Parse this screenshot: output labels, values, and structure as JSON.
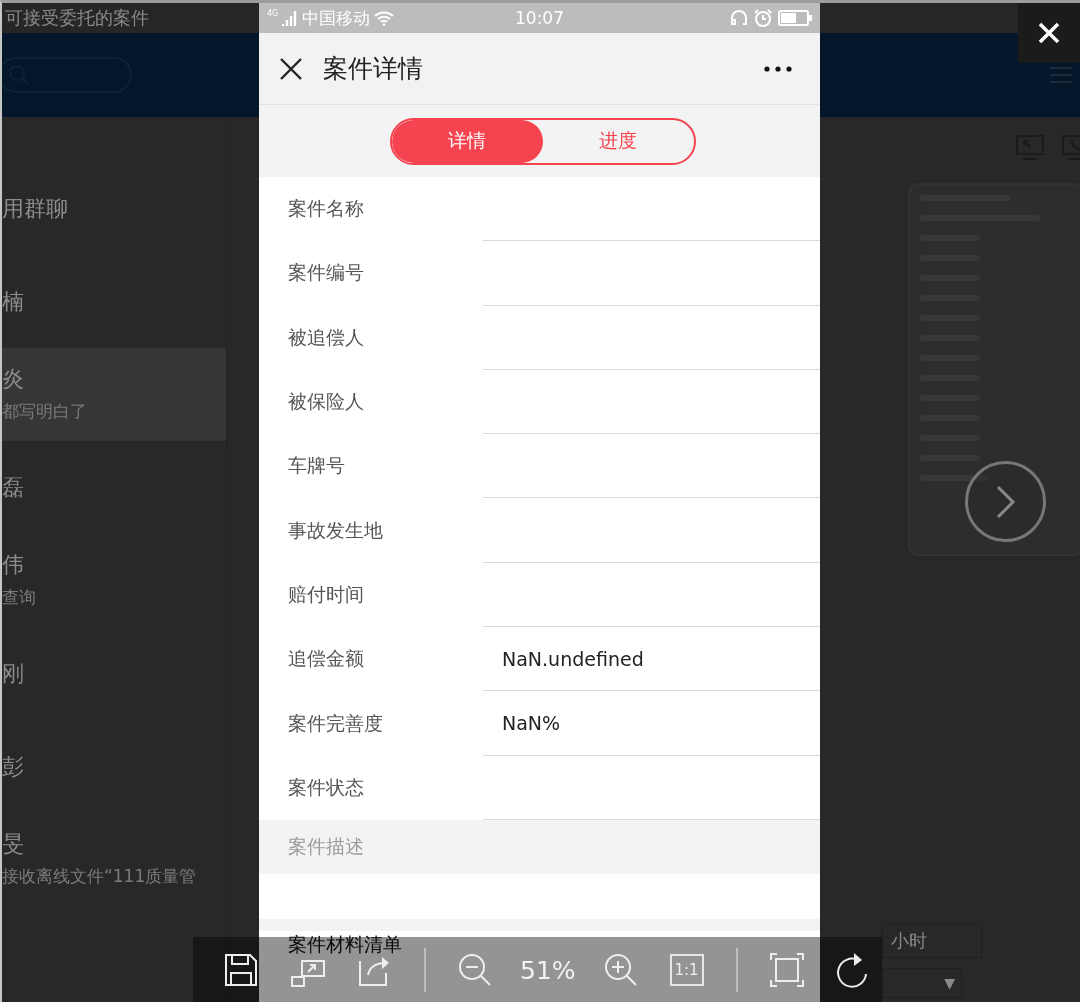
{
  "background_app": {
    "title": "可接受委托的案件",
    "contacts": [
      {
        "name": "用群聊",
        "selected": false
      },
      {
        "name": "楠",
        "selected": false
      },
      {
        "name": "炎",
        "message": "都写明白了",
        "selected": true
      },
      {
        "name": "磊",
        "selected": false
      },
      {
        "name": "伟",
        "message": "查询",
        "selected": false
      },
      {
        "name": "刚",
        "selected": false
      },
      {
        "name": "彭",
        "selected": false
      },
      {
        "name": "旻",
        "message": "接收离线文件“111质量管",
        "selected": false
      }
    ],
    "hours_label": "小时",
    "dropdown_arrow": "▼"
  },
  "phone": {
    "status_bar": {
      "network": "4G",
      "carrier": "中国移动",
      "time": "10:07"
    },
    "title": "案件详情",
    "tabs": [
      {
        "label": "详情",
        "selected": true
      },
      {
        "label": "进度",
        "selected": false
      }
    ],
    "fields": [
      {
        "label": "案件名称"
      },
      {
        "label": "案件编号"
      },
      {
        "label": "被追偿人"
      },
      {
        "label": "被保险人"
      },
      {
        "label": "车牌号"
      },
      {
        "label": "事故发生地"
      },
      {
        "label": "赔付时间"
      },
      {
        "label": "追偿金额",
        "value": "NaN.undefined"
      },
      {
        "label": "案件完善度",
        "value": "NaN%"
      },
      {
        "label": "案件状态"
      }
    ],
    "description_label": "案件描述",
    "materials_label": "案件材料清单"
  },
  "viewer": {
    "zoom": "51%",
    "actual_size": "1:1"
  }
}
